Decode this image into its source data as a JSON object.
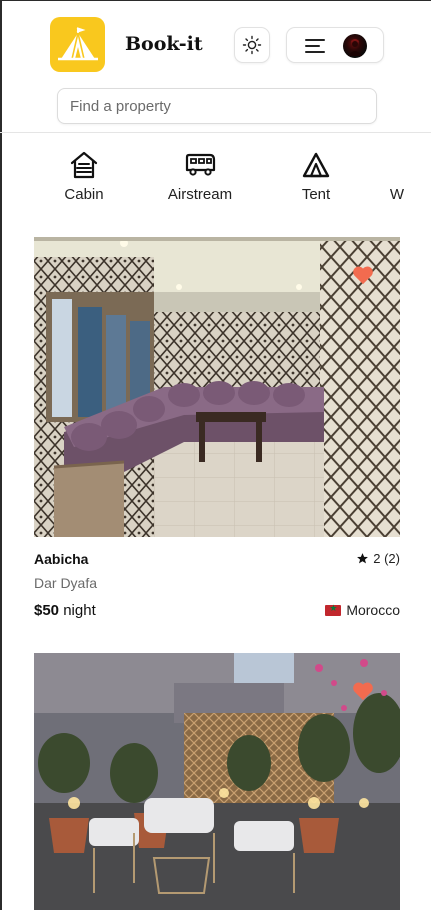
{
  "header": {
    "brand": "Book-it",
    "logo_icon": "tent-logo-icon",
    "theme_icon": "sun-icon",
    "menu_icon": "hamburger-icon",
    "accent": "#f9c81e"
  },
  "search": {
    "placeholder": "Find a property",
    "value": ""
  },
  "categories": [
    {
      "label": "Cabin",
      "icon": "cabin-icon"
    },
    {
      "label": "Airstream",
      "icon": "airstream-icon"
    },
    {
      "label": "Tent",
      "icon": "tent-icon"
    },
    {
      "label": "W",
      "icon": "partial-icon"
    }
  ],
  "listings": [
    {
      "name": "Aabicha",
      "subtitle": "Dar Dyafa",
      "rating": "2 (2)",
      "price": "$50",
      "price_unit": "night",
      "country": "Morocco",
      "favorite_color": "#f26b4f"
    },
    {
      "name": "",
      "subtitle": "",
      "rating": "",
      "price": "",
      "price_unit": "",
      "country": "",
      "favorite_color": "#f26b4f"
    }
  ]
}
